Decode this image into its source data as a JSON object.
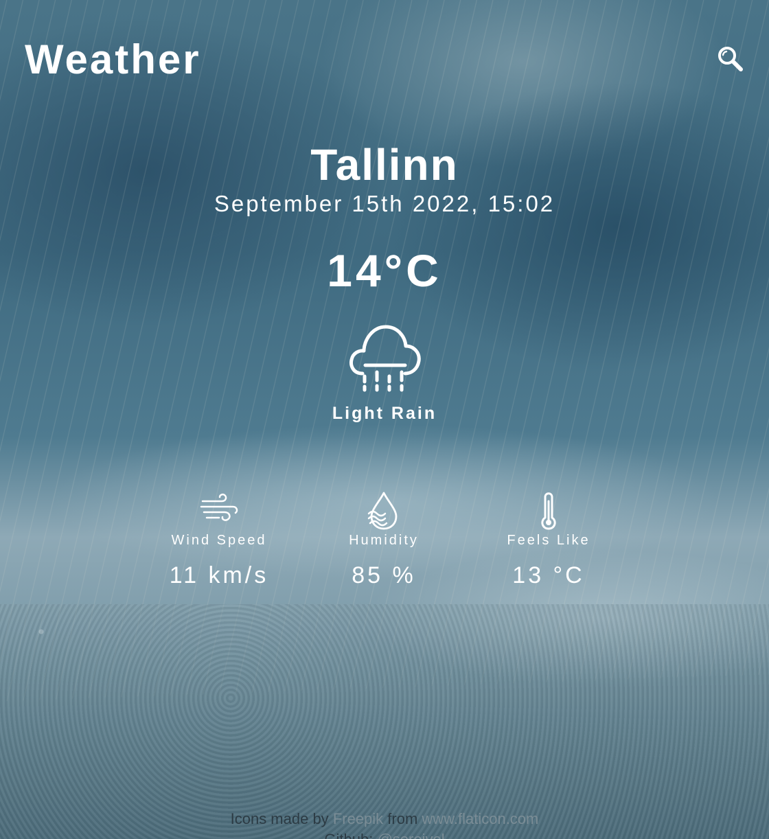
{
  "header": {
    "title": "Weather",
    "search_icon": "search-icon"
  },
  "current": {
    "city": "Tallinn",
    "datetime": "September 15th 2022, 15:02",
    "temperature": "14°C",
    "condition": "Light Rain",
    "condition_icon": "cloud-rain-icon"
  },
  "stats": {
    "wind": {
      "icon": "wind-icon",
      "label": "Wind Speed",
      "value": "11 km/s"
    },
    "humidity": {
      "icon": "humidity-icon",
      "label": "Humidity",
      "value": "85 %"
    },
    "feels_like": {
      "icon": "thermometer-icon",
      "label": "Feels Like",
      "value": "13 °C"
    }
  },
  "footer": {
    "prefix": "Icons made by",
    "author": "Freepik",
    "middle": "from",
    "site": "www.flaticon.com",
    "github_prefix": "Github:",
    "github_handle": "@sorojvel"
  },
  "colors": {
    "text": "#ffffff",
    "footer_text": "#2c3b44",
    "link": "#7b8d96"
  }
}
